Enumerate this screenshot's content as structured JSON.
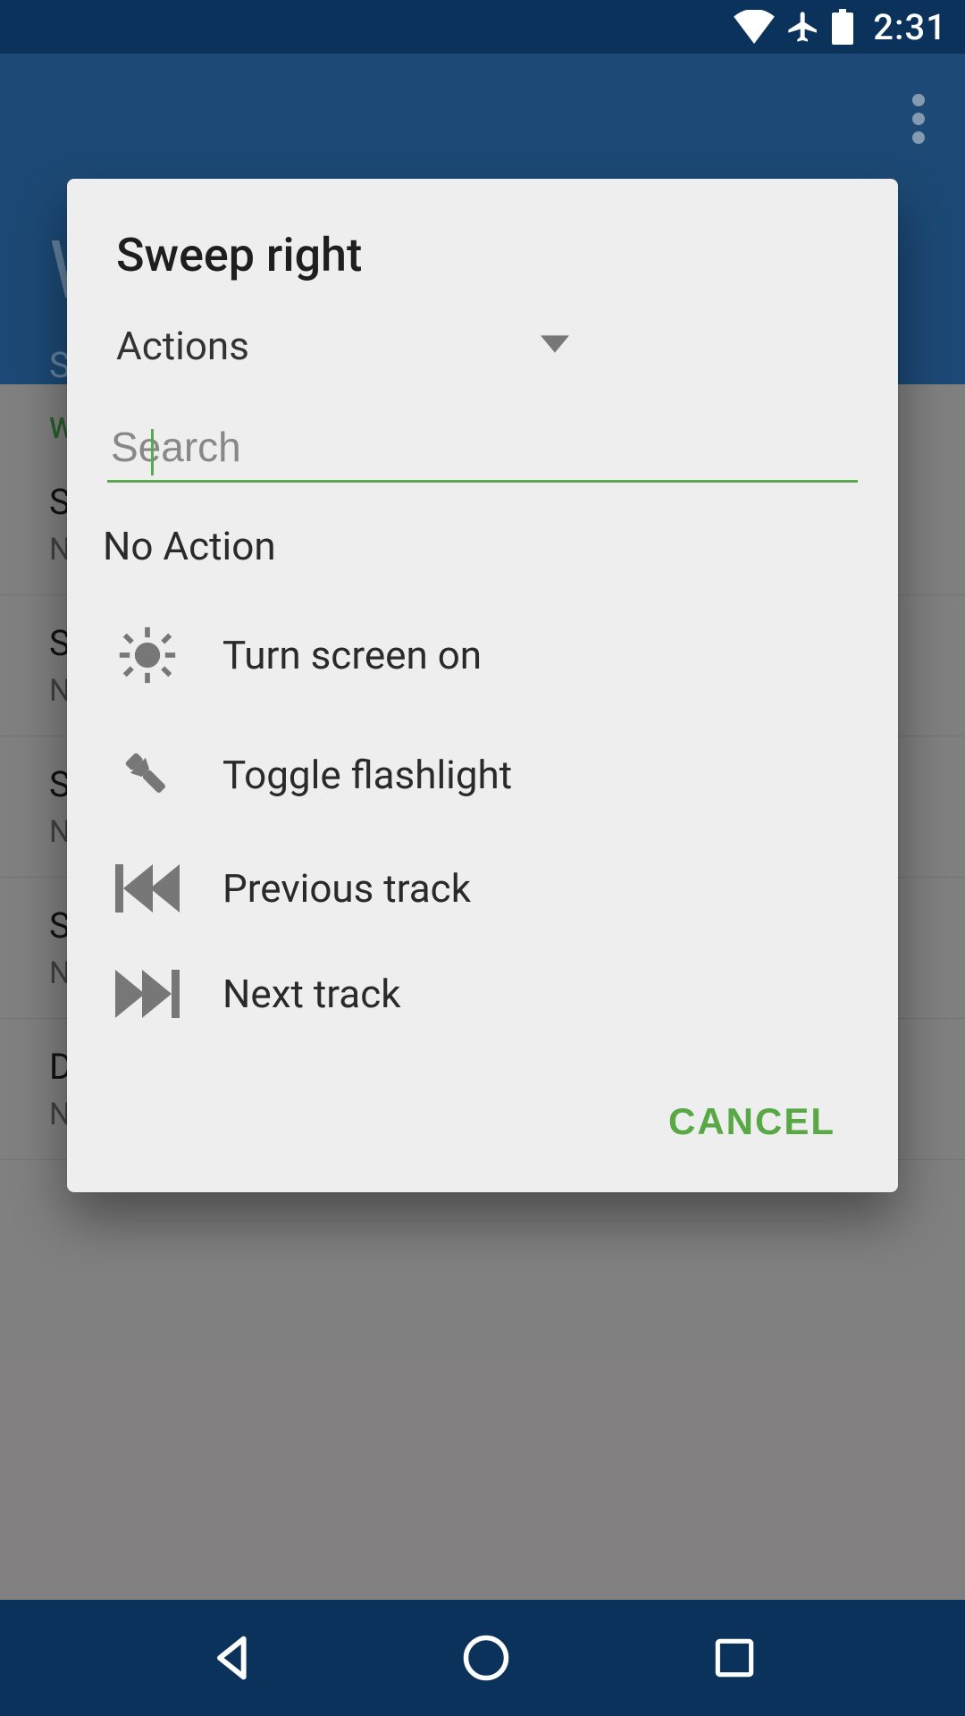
{
  "statusBar": {
    "time": "2:31"
  },
  "header": {
    "titleFirstChar": "W",
    "subtitleFirstChar": "S"
  },
  "bgList": {
    "categoryFirstChar": "W",
    "items": [
      {
        "labelFirstChar": "S",
        "subFirstChar": "N"
      },
      {
        "labelFirstChar": "S",
        "subFirstChar": "N"
      },
      {
        "labelFirstChar": "S",
        "subFirstChar": "N"
      },
      {
        "labelFirstChar": "S",
        "subFirstChar": "N"
      },
      {
        "label": "Double tap",
        "sub": "No Action"
      }
    ]
  },
  "dialog": {
    "title": "Sweep right",
    "dropdownLabel": "Actions",
    "searchPlaceholder": "Search",
    "noActionLabel": "No Action",
    "options": [
      {
        "icon": "sun-icon",
        "label": "Turn screen on"
      },
      {
        "icon": "flashlight-icon",
        "label": "Toggle flashlight"
      },
      {
        "icon": "previous-track-icon",
        "label": "Previous track"
      },
      {
        "icon": "next-track-icon",
        "label": "Next track"
      }
    ],
    "cancelLabel": "CANCEL"
  }
}
